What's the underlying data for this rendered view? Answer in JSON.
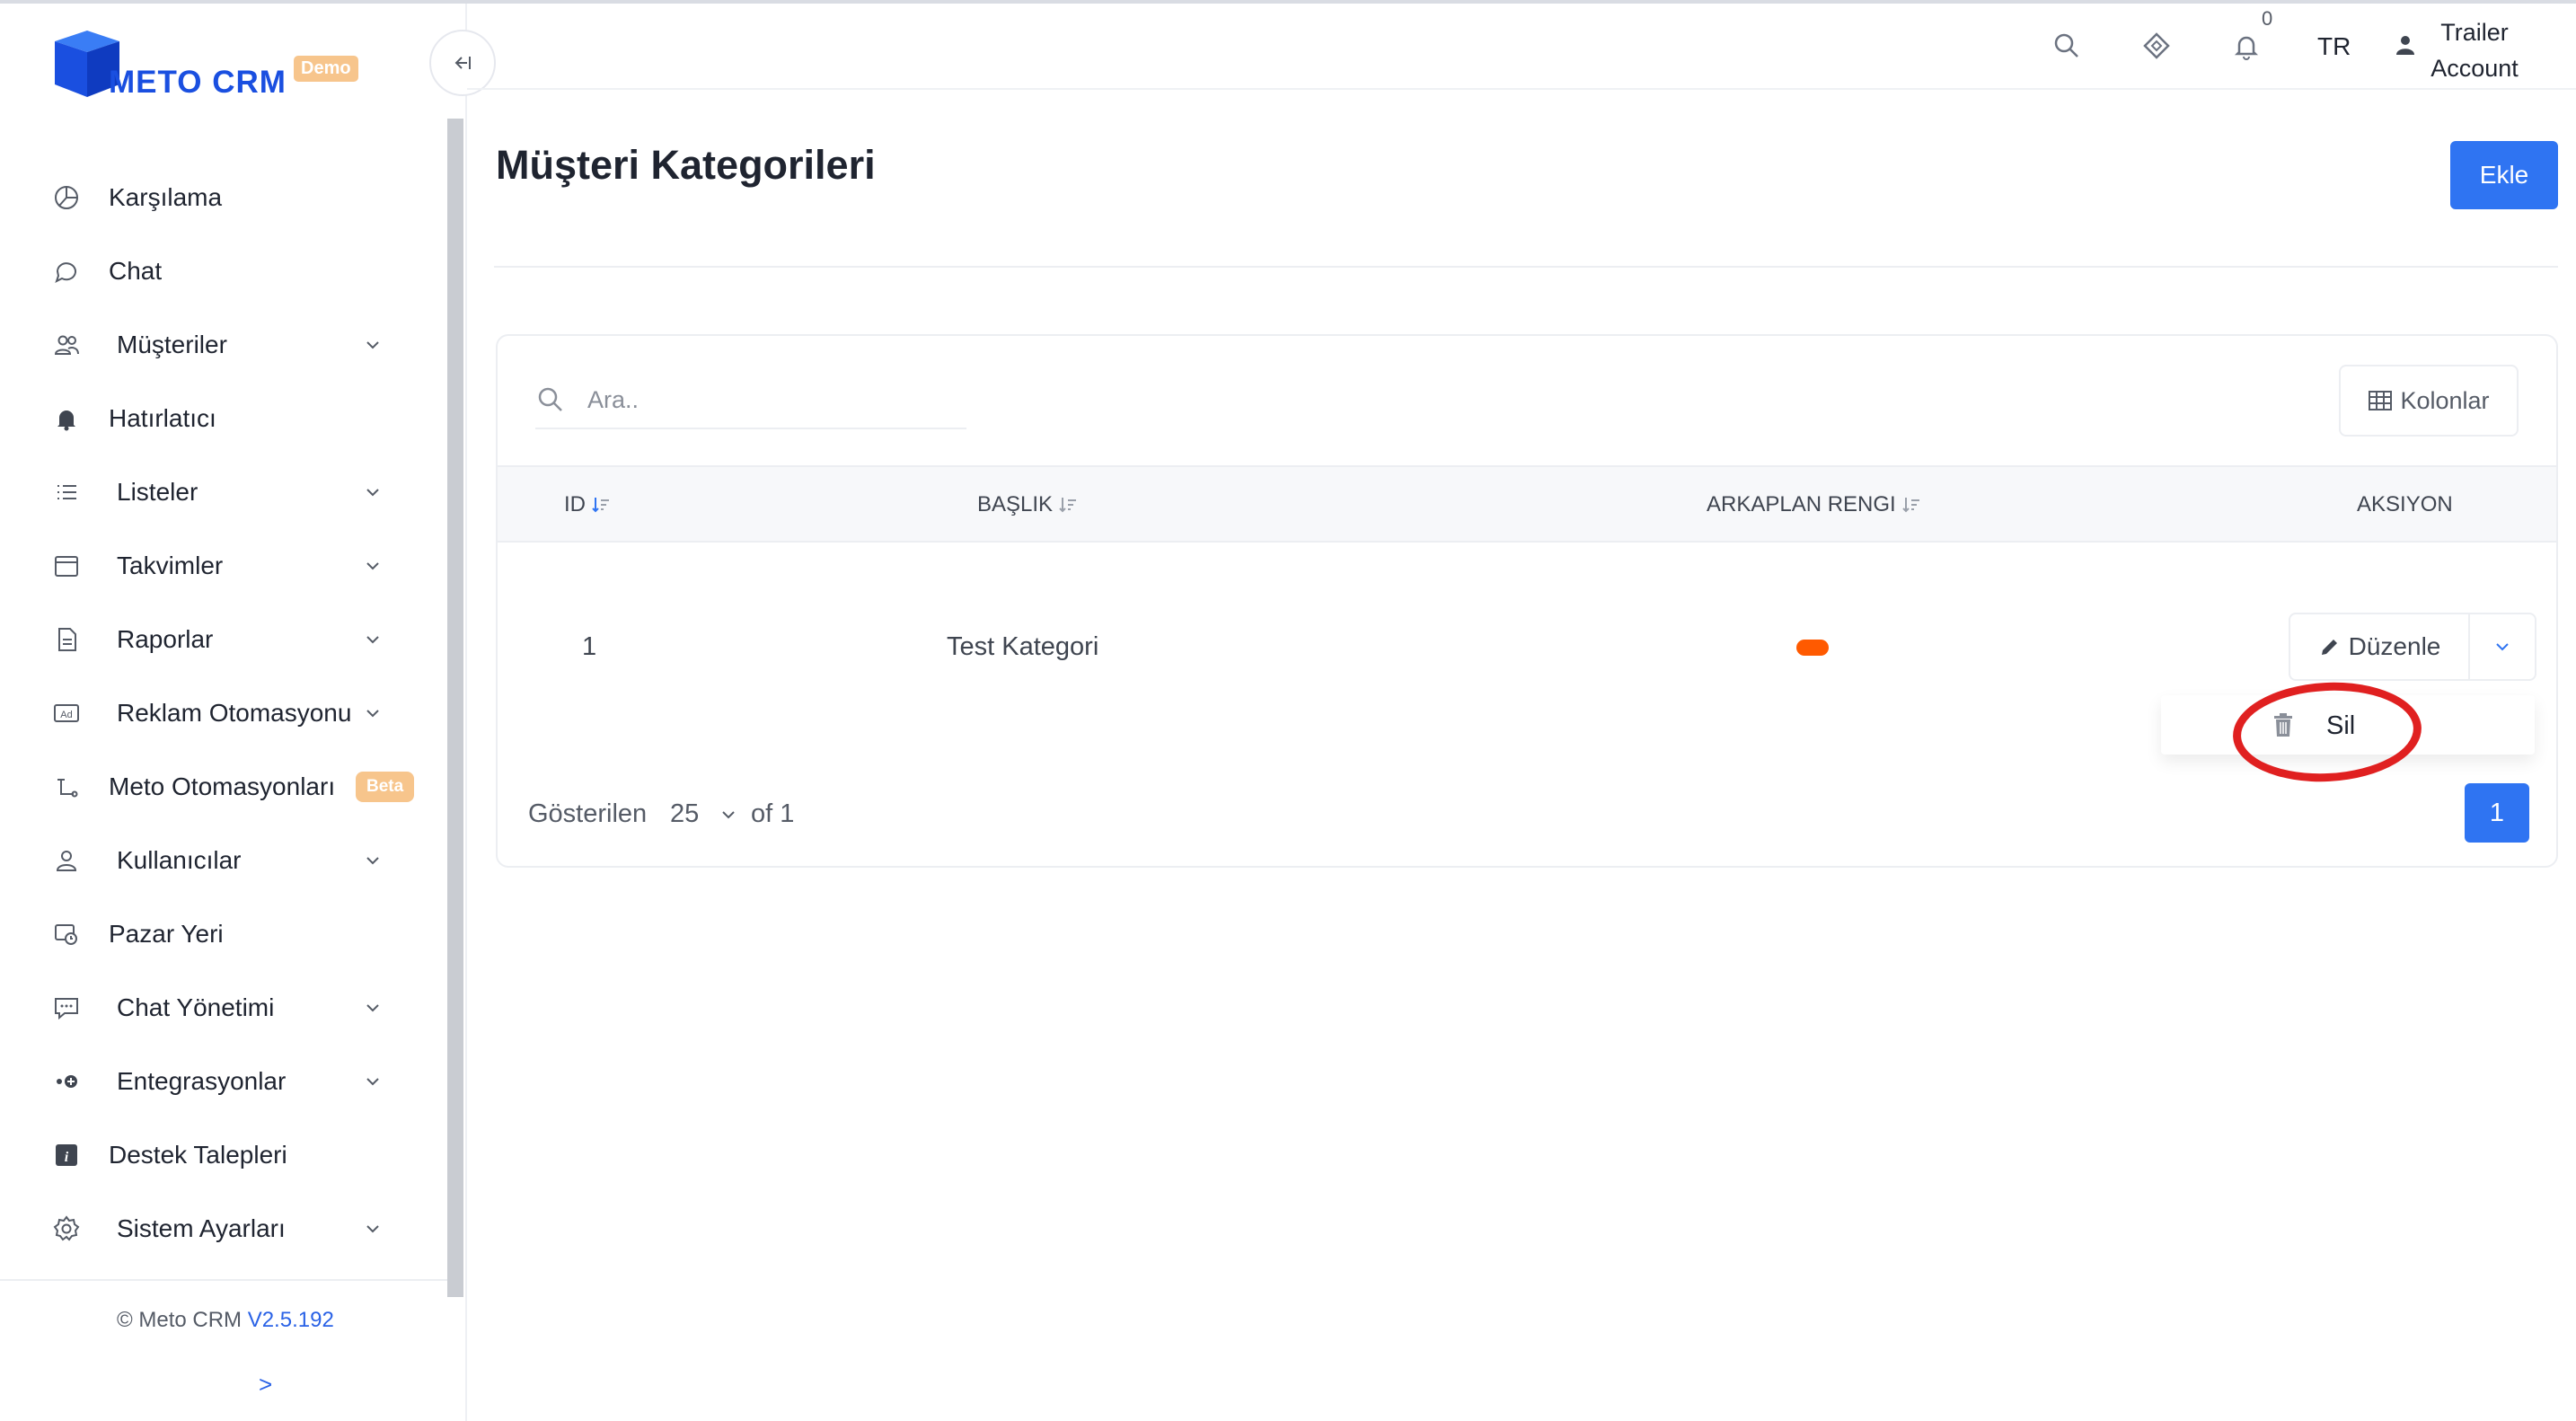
{
  "brand": {
    "name": "METO CRM",
    "badge": "Demo"
  },
  "sidebar": {
    "items": [
      {
        "label": "Karşılama",
        "icon": "pie-chart-icon",
        "has_submenu": false
      },
      {
        "label": "Chat",
        "icon": "chat-bubble-icon",
        "has_submenu": false
      },
      {
        "label": "Müşteriler",
        "icon": "users-icon",
        "has_submenu": true
      },
      {
        "label": "Hatırlatıcı",
        "icon": "bell-icon",
        "has_submenu": false
      },
      {
        "label": "Listeler",
        "icon": "list-icon",
        "has_submenu": true
      },
      {
        "label": "Takvimler",
        "icon": "calendar-icon",
        "has_submenu": true
      },
      {
        "label": "Raporlar",
        "icon": "report-icon",
        "has_submenu": true
      },
      {
        "label": "Reklam Otomasyonu",
        "icon": "ad-icon",
        "has_submenu": true
      },
      {
        "label": "Meto Otomasyonları",
        "icon": "automation-icon",
        "has_submenu": false,
        "badge": "Beta"
      },
      {
        "label": "Kullanıcılar",
        "icon": "user-icon",
        "has_submenu": true
      },
      {
        "label": "Pazar Yeri",
        "icon": "marketplace-icon",
        "has_submenu": false
      },
      {
        "label": "Chat Yönetimi",
        "icon": "chat-manage-icon",
        "has_submenu": true
      },
      {
        "label": "Entegrasyonlar",
        "icon": "integration-icon",
        "has_submenu": true
      },
      {
        "label": "Destek Talepleri",
        "icon": "info-icon",
        "has_submenu": false
      },
      {
        "label": "Sistem Ayarları",
        "icon": "gear-icon",
        "has_submenu": true
      }
    ],
    "footer": {
      "text": "© Meto CRM",
      "version": "V2.5.192",
      "expand": ">"
    }
  },
  "topbar": {
    "notification_count": "0",
    "language": "TR",
    "user_line1": "Trailer",
    "user_line2": "Account"
  },
  "page": {
    "title": "Müşteri Kategorileri",
    "add_label": "Ekle"
  },
  "table": {
    "search_placeholder": "Ara..",
    "columns_label": "Kolonlar",
    "headers": {
      "id": "ID",
      "title": "BAŞLIK",
      "bg_color": "ARKAPLAN RENGI",
      "action": "AKSIYON"
    },
    "rows": [
      {
        "id": "1",
        "title": "Test Kategori",
        "bg_color": "#ff5a00"
      }
    ],
    "edit_label": "Düzenle",
    "delete_label": "Sil"
  },
  "pagination": {
    "shown_label": "Gösterilen",
    "page_size": "25",
    "of_label": "of 1",
    "current_page": "1"
  },
  "colors": {
    "primary": "#2f74f2",
    "brand": "#1a4fe0",
    "badge": "#f7c58c",
    "highlight": "#e02020"
  }
}
